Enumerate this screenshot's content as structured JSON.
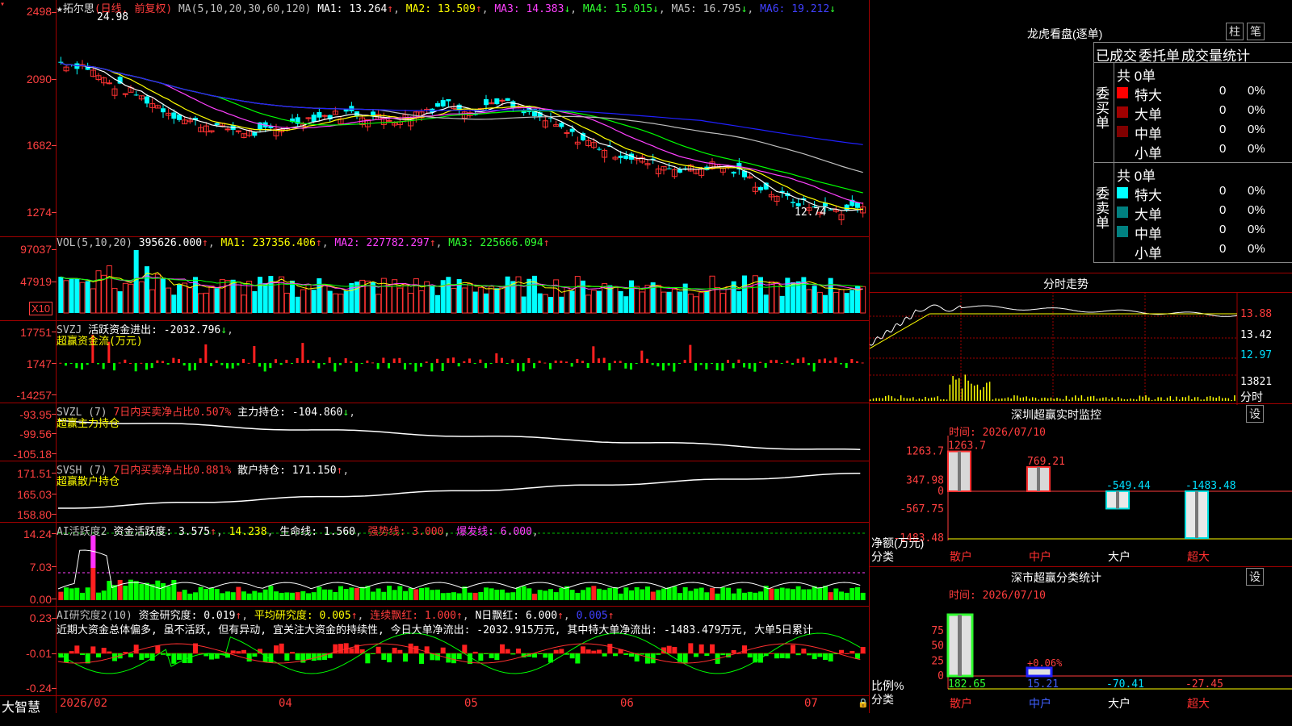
{
  "main": {
    "title_star": "★",
    "stock_name": "拓尔思",
    "period": "(日线, 前复权)",
    "ma_label": "MA(5,10,20,30,60,120)",
    "ma1": "MA1: 13.264",
    "ma2": "MA2: 13.509",
    "ma3": "MA3: 14.383",
    "ma4": "MA4: 15.015",
    "ma5": "MA5: 16.795",
    "ma6": "MA6: 19.212",
    "y_labels": [
      "2498",
      "2090",
      "1682",
      "1274"
    ],
    "high_label": "24.98",
    "low_label": "12.74"
  },
  "vol": {
    "title": "VOL(5,10,20)",
    "value": "395626.000",
    "ma1": "MA1: 237356.406",
    "ma2": "MA2: 227782.297",
    "ma3": "MA3: 225666.094",
    "y_labels": [
      "97037",
      "47919"
    ],
    "unit": "X10"
  },
  "svzj": {
    "title": "SVZJ",
    "desc": "活跃资金进出: -2032.796",
    "sub": "超赢资金流(万元)",
    "y_labels": [
      "17751",
      "1747",
      "-14257"
    ]
  },
  "svzl": {
    "title": "SVZL (7)",
    "desc_red": "7日内买卖净占比0.507%",
    "desc": "主力持仓: -104.860",
    "sub": "超赢主力持仓",
    "y_labels": [
      "-93.95",
      "-99.56",
      "-105.18"
    ]
  },
  "svsh": {
    "title": "SVSH (7)",
    "desc_red": "7日内买卖净占比0.881%",
    "desc": "散户持仓: 171.150",
    "sub": "超赢散户持仓",
    "y_labels": [
      "171.51",
      "165.03",
      "158.80"
    ]
  },
  "ai1": {
    "title": "AI活跃度2",
    "v1": "资金活跃度: 3.575",
    "v2": "14.238",
    "v3": "生命线: 1.560",
    "v4": "强势线: 3.000",
    "v5": "爆发线: 6.000",
    "y_labels": [
      "14.24",
      "7.03",
      "0.00"
    ]
  },
  "ai2": {
    "title": "AI研究度2(10)",
    "v1": "资金研究度: 0.019",
    "v2": "平均研究度: 0.005",
    "v3": "连续飘红: 1.000",
    "v4": "N日飘红: 6.000",
    "v5": "0.005",
    "comment": "近期大资金总体偏多, 虽不活跃, 但有异动, 宜关注大资金的持续性, 今日大单净流出: -2032.915万元, 其中特大单净流出: -1483.479万元, 大单5日累计",
    "y_labels": [
      "0.23",
      "-0.01",
      "-0.24"
    ]
  },
  "bottom_axis": {
    "app": "大智慧",
    "labels": [
      "2026/02",
      "04",
      "05",
      "06",
      "07"
    ]
  },
  "right": {
    "lhkp_title": "龙虎看盘(逐单)",
    "btn_zhu": "柱",
    "btn_bi": "笔",
    "tabs": [
      "已成交",
      "委托单",
      "成交量统计"
    ],
    "buy_group": {
      "label": "委买单",
      "total": "共 0单",
      "rows": [
        {
          "name": "特大",
          "count": "0",
          "pct": "0%",
          "color": "#ff0000"
        },
        {
          "name": "大单",
          "count": "0",
          "pct": "0%",
          "color": "#a00000"
        },
        {
          "name": "中单",
          "count": "0",
          "pct": "0%",
          "color": "#800000"
        },
        {
          "name": "小单",
          "count": "0",
          "pct": "0%",
          "color": "#000000"
        }
      ]
    },
    "sell_group": {
      "label": "委卖单",
      "total": "共 0单",
      "rows": [
        {
          "name": "特大",
          "count": "0",
          "pct": "0%",
          "color": "#00ffff"
        },
        {
          "name": "大单",
          "count": "0",
          "pct": "0%",
          "color": "#008080"
        },
        {
          "name": "中单",
          "count": "0",
          "pct": "0%",
          "color": "#008080"
        },
        {
          "name": "小单",
          "count": "0",
          "pct": "0%",
          "color": "#000000"
        }
      ]
    },
    "fs_title": "分时走势",
    "fs_prices": [
      "13.88",
      "13.42",
      "12.97"
    ],
    "fs_vol": "13821",
    "fs_unit": "分时",
    "szcy_title": "深圳超赢实时监控",
    "szcy_btn": "设",
    "szcy_time": "时间: 2026/07/10",
    "szcy_ylabels": [
      "1263.7",
      "347.98",
      "0",
      "-567.75",
      "-1483.48"
    ],
    "szcy_ytitle": "净额(万元)",
    "szcy_xtitle": "分类",
    "szcy_cats": [
      "散户",
      "中户",
      "大户",
      "超大"
    ],
    "szcy_values": [
      1263.7,
      769.21,
      -549.44,
      -1483.48
    ],
    "szcy_value_labels": [
      "1263.7",
      "769.21",
      "-549.44",
      "-1483.48"
    ],
    "sscy_title": "深市超赢分类统计",
    "sscy_btn": "设",
    "sscy_time": "时间: 2026/07/10",
    "sscy_ylabels": [
      "75",
      "50",
      "25",
      "0"
    ],
    "sscy_ytitle": "比例%",
    "sscy_xtitle": "分类",
    "sscy_cats": [
      "散户",
      "中户",
      "大户",
      "超大"
    ],
    "sscy_values": [
      "182.65",
      "15.21",
      "-70.41",
      "-27.45"
    ],
    "sscy_bar_label": "+0.06%"
  },
  "colors": {
    "up": "#ff3232",
    "down": "#00ffff",
    "grid": "#a00000",
    "ma1": "#ffffff",
    "ma2": "#ffff00",
    "ma3": "#ff40ff",
    "ma4": "#00ff00",
    "ma5": "#c0c0c0",
    "ma6": "#2020ff"
  },
  "chart_data": {
    "type": "candlestick",
    "title": "拓尔思 (日线, 前复权)",
    "x_range": [
      "2026/02",
      "2026/07/10"
    ],
    "ylim": [
      12.74,
      24.98
    ],
    "price_high": 24.98,
    "price_low": 12.74,
    "moving_averages": {
      "MA1": 13.264,
      "MA2": 13.509,
      "MA3": 14.383,
      "MA4": 15.015,
      "MA5": 16.795,
      "MA6": 19.212
    },
    "approx_close_path": [
      22.1,
      21.9,
      20.8,
      20.2,
      19.4,
      18.6,
      18.2,
      18.0,
      17.7,
      18.0,
      18.6,
      18.8,
      19.0,
      18.7,
      18.6,
      19.2,
      19.6,
      19.1,
      19.8,
      19.0,
      18.5,
      17.6,
      17.0,
      16.4,
      16.0,
      15.6,
      15.5,
      15.8,
      15.2,
      14.2,
      13.6,
      13.1,
      12.9,
      13.2
    ],
    "volume_unit": "X10",
    "volume_last": 395626.0
  }
}
